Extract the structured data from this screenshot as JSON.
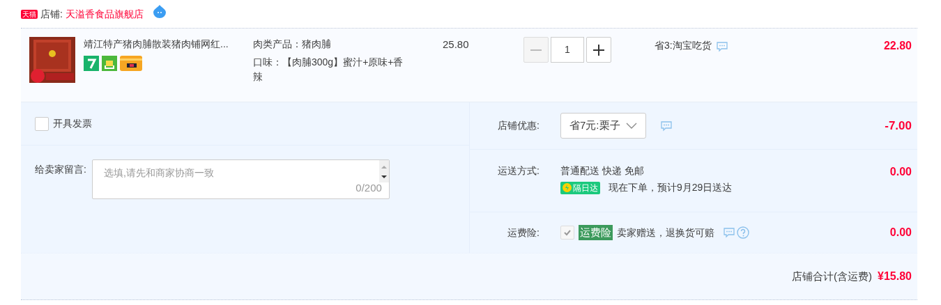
{
  "shop": {
    "badge": "天猫",
    "label": "店铺:",
    "name": "天溢香食品旗舰店"
  },
  "item": {
    "title": "靖江特产猪肉脯散装猪肉铺网红...",
    "attributes": [
      "肉类产品：猪肉脯",
      "口味：【肉脯300g】蜜汁+原味+香辣"
    ],
    "price": "25.80",
    "quantity": "1",
    "decrease_disabled": true,
    "promo": "省3:淘宝吃货",
    "subtotal": "22.80"
  },
  "invoice": {
    "label": "开具发票",
    "checked": false
  },
  "message": {
    "label": "给卖家留言:",
    "placeholder": "选填,请先和商家协商一致",
    "counter": "0/200"
  },
  "coupon": {
    "label": "店铺优惠:",
    "value": "省7元:栗子",
    "amount": "-7.00"
  },
  "shipping": {
    "label": "运送方式:",
    "method": "普通配送 快递 免邮",
    "badge": "隔日达",
    "eta": "现在下单，预计9月29日送达",
    "amount": "0.00"
  },
  "insurance": {
    "label": "运费险:",
    "checked": true,
    "disabled": true,
    "tag": "运费险",
    "text": "卖家赠送，退换货可赔",
    "amount": "0.00"
  },
  "total": {
    "label": "店铺合计(含运费)",
    "amount": "¥15.80"
  }
}
